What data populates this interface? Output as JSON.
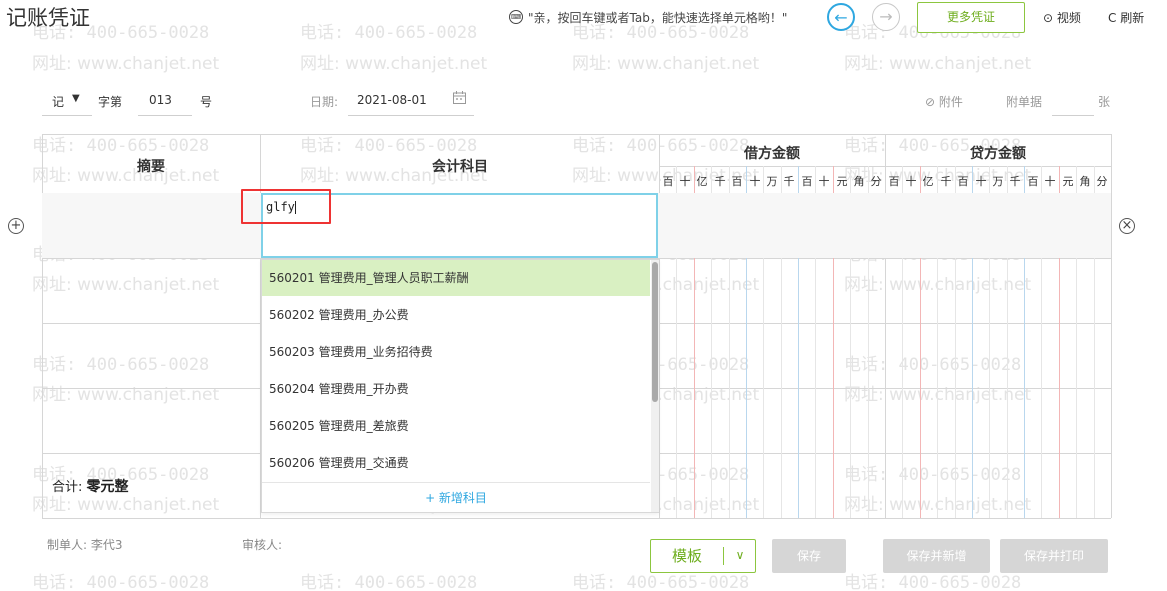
{
  "app": {
    "title": "记账凭证"
  },
  "toolbar": {
    "tip_icon": "⌨",
    "tip": "\"亲，按回车键或者Tab，能快速选择单元格哟！\"",
    "prev_symbol": "←",
    "next_symbol": "→",
    "more_label": "更多凭证",
    "video_label": "视频",
    "video_icon": "⊙",
    "refresh_label": "刷新",
    "refresh_icon": "C"
  },
  "header": {
    "type": "记",
    "type_arrow": "▼",
    "zi_label": "字第",
    "number": "013",
    "hao_label": "号",
    "date_label": "日期:",
    "date": "2021-08-01",
    "attach_icon": "⊘",
    "attach_label": "附件",
    "bill_label": "附单据",
    "unit": "张"
  },
  "table": {
    "col_summary": "摘要",
    "col_account": "会计科目",
    "col_debit": "借方金额",
    "col_credit": "贷方金额",
    "digits": [
      "百",
      "十",
      "亿",
      "千",
      "百",
      "十",
      "万",
      "千",
      "百",
      "十",
      "元",
      "角",
      "分"
    ],
    "add_row_icon": "+",
    "delete_row_icon": "×",
    "total_label": "合计:",
    "total_value": "零元整"
  },
  "entry": {
    "input_value": "glfy"
  },
  "dropdown": {
    "items": [
      "560201 管理费用_管理人员职工薪酬",
      "560202 管理费用_办公费",
      "560203 管理费用_业务招待费",
      "560204 管理费用_开办费",
      "560205 管理费用_差旅费",
      "560206 管理费用_交通费"
    ],
    "add_label": "+ 新增科目"
  },
  "footer": {
    "maker_label": "制单人:",
    "maker": "李代3",
    "reviewer_label": "审核人:",
    "template_label": "模板",
    "template_arrow": "∨",
    "save": "保存",
    "save_new": "保存并新增",
    "save_print": "保存并打印"
  },
  "watermark": {
    "phone": "电话: 400-665-0028",
    "url": "网址: www.chanjet.net"
  },
  "colors": {
    "accent_blue": "#2ea7e0",
    "accent_green": "#8cc63f",
    "highlight_red": "#e33333",
    "selected_row": "#d9f0c2"
  }
}
